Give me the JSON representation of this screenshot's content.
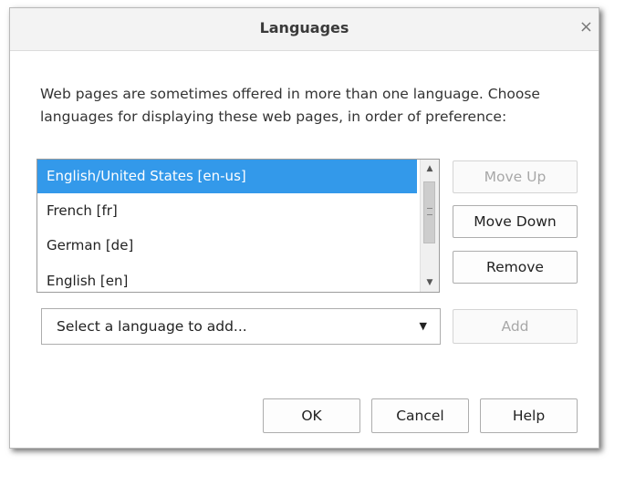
{
  "dialog": {
    "title": "Languages",
    "close_glyph": "×",
    "description": "Web pages are sometimes offered in more than one language. Choose languages for displaying these web pages, in order of preference:"
  },
  "languages": {
    "items": [
      {
        "label": "English/United States  [en-us]",
        "selected": true
      },
      {
        "label": "French  [fr]",
        "selected": false
      },
      {
        "label": "German  [de]",
        "selected": false
      },
      {
        "label": "English  [en]",
        "selected": false
      }
    ],
    "scroll_up_glyph": "▲",
    "scroll_down_glyph": "▼"
  },
  "buttons": {
    "move_up": "Move Up",
    "move_down": "Move Down",
    "remove": "Remove",
    "add": "Add",
    "ok": "OK",
    "cancel": "Cancel",
    "help": "Help"
  },
  "add_select": {
    "placeholder": "Select a language to add...",
    "arrow_glyph": "▼"
  },
  "colors": {
    "selection": "#3399ea",
    "disabled_text": "#a8a8a8"
  }
}
